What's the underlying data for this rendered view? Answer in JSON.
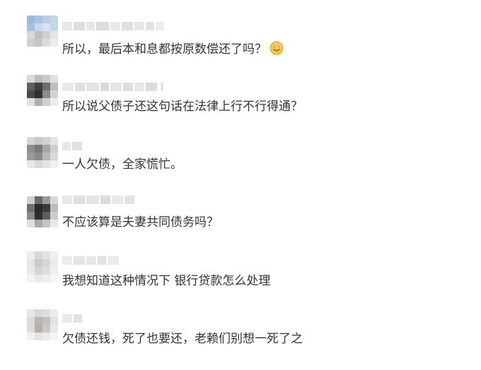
{
  "comments": [
    {
      "name_suffix": "",
      "text": "所以，最后本和息都按原数偿还了吗？",
      "emoji": "smile-emoji-icon"
    },
    {
      "name_suffix": "]",
      "text": "所以说父债子还这句话在法律上行不行得通？",
      "emoji": ""
    },
    {
      "name_suffix": "",
      "text": "一人欠债，全家慌忙。",
      "emoji": ""
    },
    {
      "name_suffix": "",
      "text": "不应该算是夫妻共同债务吗？",
      "emoji": ""
    },
    {
      "name_suffix": "",
      "text": "我想知道这种情况下 银行贷款怎么处理",
      "emoji": ""
    },
    {
      "name_suffix": "",
      "text": "欠债还钱，死了也要还，老赖们别想一死了之",
      "emoji": ""
    }
  ],
  "colors": {
    "text": "#333333",
    "blur_light": "#e6e6e6",
    "blur_mid": "#bdbdbd",
    "blur_dark": "#5a5a5a",
    "avatar_blue": "#aac4e6"
  }
}
